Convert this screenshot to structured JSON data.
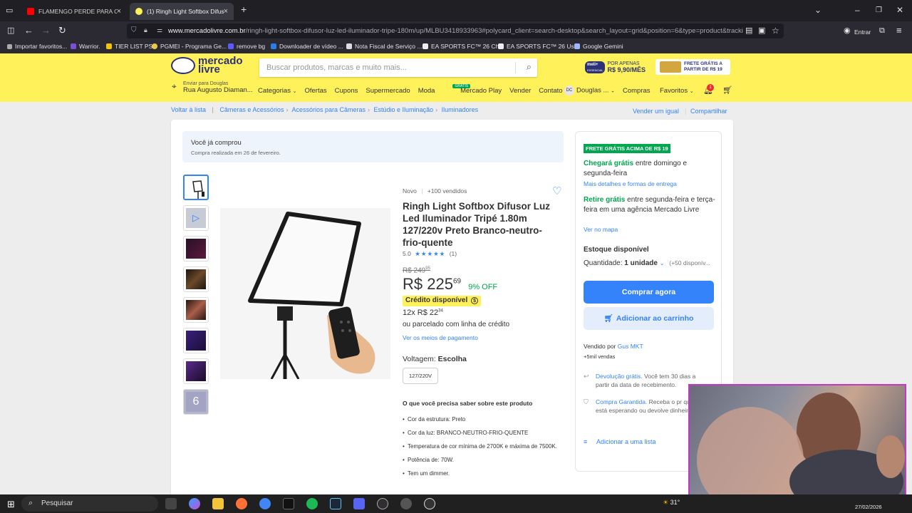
{
  "browser": {
    "tabs": [
      {
        "title": "FLAMENGO PERDE PARA O LAN",
        "color": "#ff0000"
      },
      {
        "title": "(1) Ringh Light Softbox Difusor",
        "color": "#fff159"
      }
    ],
    "new_tab": "+",
    "url_domain": "www.mercadolivre.com.br",
    "url_path": "/ringh-light-softbox-difusor-luz-led-iluminador-tripe-180m/up/MLBU3418933963#polycard_client=search-desktop&search_layout=grid&position=6&type=product&tracki",
    "account_label": "Entrar",
    "bookmarks": [
      "Importar favoritos...",
      "Warrior.",
      "TIER LIST PS",
      "PGMEI - Programa Ge...",
      "remove bg",
      "Downloader de vídeo ...",
      "Nota Fiscal de Serviço ...",
      "EA SPORTS FC™ 26 Ch...",
      "EA SPORTS FC™ 26 Us...",
      "Google Gemini"
    ]
  },
  "header": {
    "logo_line1": "mercado",
    "logo_line2": "livre",
    "search_placeholder": "Buscar produtos, marcas e muito mais...",
    "promo1_brand": "meli+",
    "promo1_sub": "ESSENCIAL",
    "promo1_label": "POR APENAS",
    "promo1_price": "R$ 9,90/MÊS",
    "promo2_text": "FRETE GRÁTIS A PARTIR DE R$ 19",
    "address_label": "Enviar para Douglas",
    "address_value": "Rua Augusto Diaman...",
    "nav": [
      "Categorias",
      "Ofertas",
      "Cupons",
      "Supermercado",
      "Moda",
      "Mercado Play",
      "Vender",
      "Contato"
    ],
    "gratis_badge": "GRÁTIS",
    "user_initials": "DC",
    "user_name": "Douglas ...",
    "compras": "Compras",
    "favoritos": "Favoritos",
    "notif_count": "1",
    "accent": "#fff159",
    "brand_blue": "#3483fa"
  },
  "breadcrumb": {
    "back": "Voltar à lista",
    "items": [
      "Câmeras e Acessórios",
      "Acessórios para Câmeras",
      "Estúdio e Iluminação",
      "Iluminadores"
    ],
    "sell_same": "Vender um igual",
    "share": "Compartilhar"
  },
  "purchase_notice": {
    "title": "Você já comprou",
    "subtitle": "Compra realizada em 26 de fevereiro."
  },
  "gallery": {
    "more_count": "6"
  },
  "product": {
    "condition": "Novo",
    "sold": "+100 vendidos",
    "title": "Ringh Light Softbox Difusor Luz Led Iluminador Tripé 1.80m 127/220v Preto Branco-neutro-frio-quente",
    "rating_value": "5.0",
    "rating_stars": "★★★★★",
    "rating_count": "(1)",
    "old_price": "R$ 249",
    "old_cents": "95",
    "price": "R$ 225",
    "price_cents": "69",
    "discount": "9% OFF",
    "credit_label": "Crédito disponível",
    "installments": "12x R$ 22",
    "installments_cents": "34",
    "credit_line": "ou parcelado com linha de crédito",
    "payment_link": "Ver os meios de pagamento",
    "voltage_label": "Voltagem:",
    "voltage_value": "Escolha",
    "voltage_option": "127/220V",
    "know_title": "O que você precisa saber sobre este produto",
    "features": [
      "Cor da estrutura: Preto",
      "Cor da luz: BRANCO-NEUTRO-FRIO-QUENTE",
      "Temperatura de cor mínima de 2700K e máxima de 7500K.",
      "Potência de: 70W.",
      "Tem um dimmer."
    ]
  },
  "buybox": {
    "shipping_badge": "FRETE GRÁTIS ACIMA DE R$ 19",
    "arrives_green": "Chegará grátis",
    "arrives_rest": "entre domingo e segunda-feira",
    "delivery_link": "Mais detalhes e formas de entrega",
    "pickup_green": "Retire grátis",
    "pickup_rest": "entre segunda-feira e terça-feira em uma agência Mercado Livre",
    "map_link": "Ver no mapa",
    "stock": "Estoque disponível",
    "qty_label": "Quantidade:",
    "qty_value": "1 unidade",
    "qty_avail": "(+50 disponív...",
    "buy_now": "Comprar agora",
    "add_cart": "Adicionar ao carrinho",
    "sold_by": "Vendido por",
    "seller": "Gus MKT",
    "seller_sales": "+5mil vendas",
    "return_link": "Devolução grátis.",
    "return_text": "Você tem 30 dias a partir da data de recebimento.",
    "guarantee_link": "Compra Garantida.",
    "guarantee_text": "Receba o pr que está esperando ou devolve dinheiro.",
    "add_list": "Adicionar a uma lista"
  },
  "taskbar": {
    "search": "Pesquisar",
    "weather": "31°",
    "date": "27/02/2026"
  }
}
